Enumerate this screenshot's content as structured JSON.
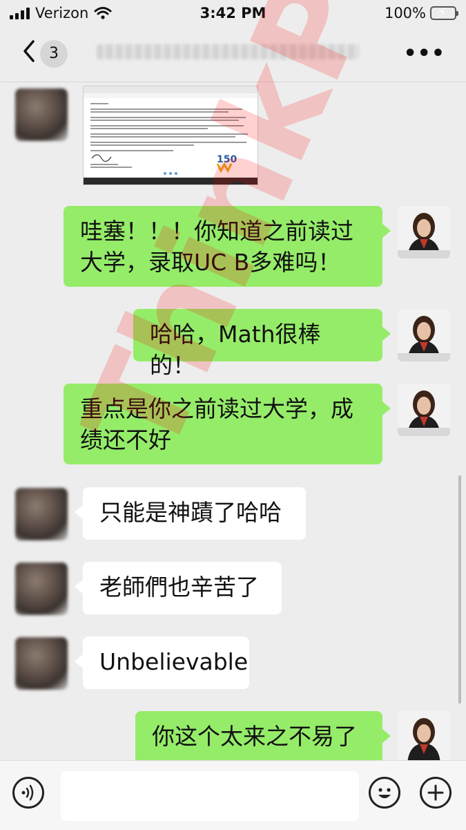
{
  "status_bar": {
    "carrier": "Verizon",
    "time": "3:42 PM",
    "battery": "100%"
  },
  "nav": {
    "unread_count": "3"
  },
  "messages": [
    {
      "side": "left",
      "type": "image",
      "image_desc": "screenshot of admission letter"
    },
    {
      "side": "right",
      "type": "text",
      "line1": "哇塞！！！你知道之前读过",
      "line2": "大学，录取UC B多难吗！"
    },
    {
      "side": "right",
      "type": "text",
      "text": "哈哈，Math很棒的！"
    },
    {
      "side": "right",
      "type": "text",
      "line1": "重点是你之前读过大学，成",
      "line2": "绩还不好"
    },
    {
      "side": "left",
      "type": "text",
      "text": "只能是神蹟了哈哈"
    },
    {
      "side": "left",
      "type": "text",
      "text": "老師們也辛苦了"
    },
    {
      "side": "left",
      "type": "text",
      "text": "Unbelievable"
    },
    {
      "side": "right",
      "type": "text",
      "text": "你这个太来之不易了"
    }
  ],
  "watermark": "ThinkPro",
  "icons": {
    "back": "chevron-left-icon",
    "more": "more-icon",
    "voice": "voice-icon",
    "emoji": "emoji-icon",
    "plus": "plus-icon"
  },
  "colors": {
    "bubble_self": "#95ec69",
    "bubble_other": "#ffffff",
    "background": "#ededed"
  }
}
